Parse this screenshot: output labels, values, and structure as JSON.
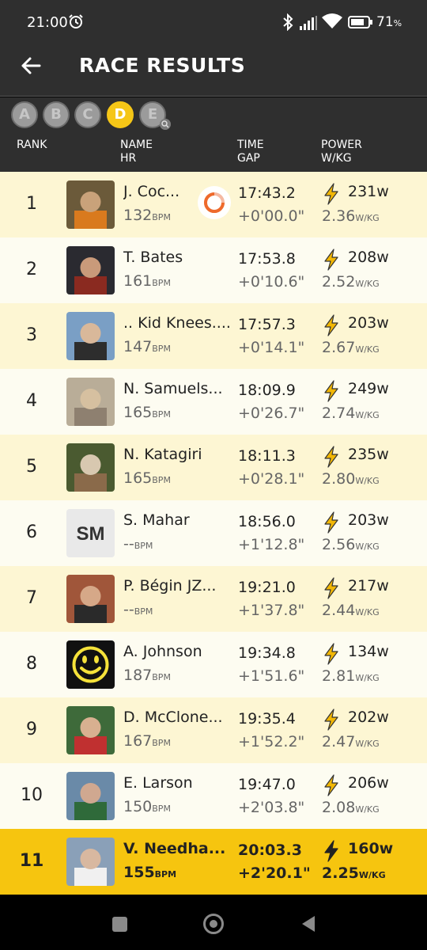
{
  "status": {
    "time": "21:00",
    "battery": "71",
    "battery_unit": "%"
  },
  "header": {
    "title": "RACE RESULTS"
  },
  "categories": [
    {
      "label": "A",
      "active": false
    },
    {
      "label": "B",
      "active": false
    },
    {
      "label": "C",
      "active": false
    },
    {
      "label": "D",
      "active": true
    },
    {
      "label": "E",
      "active": false
    }
  ],
  "columns": {
    "rank": "RANK",
    "name": "NAME",
    "hr": "HR",
    "time": "TIME",
    "gap": "GAP",
    "power": "POWER",
    "wkg": "W/KG"
  },
  "units": {
    "bpm": "BPM",
    "wkg": "W/KG"
  },
  "rows": [
    {
      "rank": "1",
      "name": "J. Coc...",
      "hr": "132",
      "time": "17:43.2",
      "gap": "+0'00.0\"",
      "power": "231w",
      "wkg": "2.36",
      "avatar": "photo",
      "ring": true
    },
    {
      "rank": "2",
      "name": "T. Bates",
      "hr": "161",
      "time": "17:53.8",
      "gap": "+0'10.6\"",
      "power": "208w",
      "wkg": "2.52",
      "avatar": "photo"
    },
    {
      "rank": "3",
      "name": ".. Kid Knees....",
      "hr": "147",
      "time": "17:57.3",
      "gap": "+0'14.1\"",
      "power": "203w",
      "wkg": "2.67",
      "avatar": "photo"
    },
    {
      "rank": "4",
      "name": "N. Samuels...",
      "hr": "165",
      "time": "18:09.9",
      "gap": "+0'26.7\"",
      "power": "249w",
      "wkg": "2.74",
      "avatar": "photo"
    },
    {
      "rank": "5",
      "name": "N. Katagiri",
      "hr": "165",
      "time": "18:11.3",
      "gap": "+0'28.1\"",
      "power": "235w",
      "wkg": "2.80",
      "avatar": "photo"
    },
    {
      "rank": "6",
      "name": "S. Mahar",
      "hr": "--",
      "time": "18:56.0",
      "gap": "+1'12.8\"",
      "power": "203w",
      "wkg": "2.56",
      "avatar": "initials",
      "initials": "SM"
    },
    {
      "rank": "7",
      "name": "P. Bégin JZ...",
      "hr": "--",
      "time": "19:21.0",
      "gap": "+1'37.8\"",
      "power": "217w",
      "wkg": "2.44",
      "avatar": "photo"
    },
    {
      "rank": "8",
      "name": "A. Johnson",
      "hr": "187",
      "time": "19:34.8",
      "gap": "+1'51.6\"",
      "power": "134w",
      "wkg": "2.81",
      "avatar": "smiley"
    },
    {
      "rank": "9",
      "name": "D. McClone...",
      "hr": "167",
      "time": "19:35.4",
      "gap": "+1'52.2\"",
      "power": "202w",
      "wkg": "2.47",
      "avatar": "photo"
    },
    {
      "rank": "10",
      "name": "E. Larson",
      "hr": "150",
      "time": "19:47.0",
      "gap": "+2'03.8\"",
      "power": "206w",
      "wkg": "2.08",
      "avatar": "photo"
    },
    {
      "rank": "11",
      "name": "V. Needha...",
      "hr": "155",
      "time": "20:03.3",
      "gap": "+2'20.1\"",
      "power": "160w",
      "wkg": "2.25",
      "avatar": "photo",
      "me": true
    }
  ],
  "colors": {
    "accent": "#f6c50f",
    "header_bg": "#2f2f2f",
    "row_odd": "#fdf6d3",
    "row_even": "#fdfcf1"
  },
  "icons": [
    "back-arrow-icon",
    "alarm-icon",
    "bluetooth-icon",
    "signal-icon",
    "wifi-icon",
    "battery-icon",
    "lightning-bolt-icon",
    "search-icon",
    "loading-ring-icon"
  ]
}
